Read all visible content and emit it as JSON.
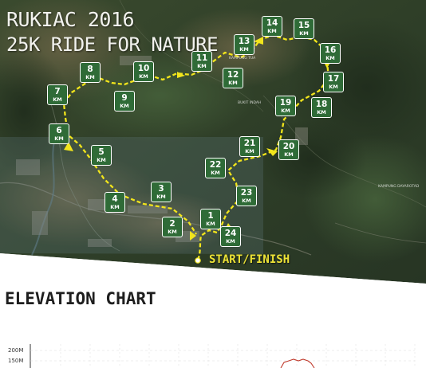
{
  "title_line1": "RUKIAC 2016",
  "title_line2": "25K RIDE FOR NATURE",
  "start_finish_label": "START/FINISH",
  "elevation_title": "ELEVATION CHART",
  "elevation_y_ticks": [
    "200M",
    "150M"
  ],
  "km_unit": "KM",
  "km_markers": [
    "1",
    "2",
    "3",
    "4",
    "5",
    "6",
    "7",
    "8",
    "9",
    "10",
    "11",
    "12",
    "13",
    "14",
    "15",
    "16",
    "17",
    "18",
    "19",
    "20",
    "21",
    "22",
    "23",
    "24"
  ],
  "place_labels": [
    "KAMPUNG TUA",
    "BUKIT INDAH",
    "KAMPUNG DAYAROTAD"
  ],
  "colors": {
    "route": "#f2e51c",
    "marker_bg": "#2f6b37",
    "marker_border": "#ffffff",
    "elevation_line": "#c0392b"
  },
  "elevation_series_visible_m": [
    130,
    150,
    158,
    150,
    157,
    153,
    140
  ]
}
